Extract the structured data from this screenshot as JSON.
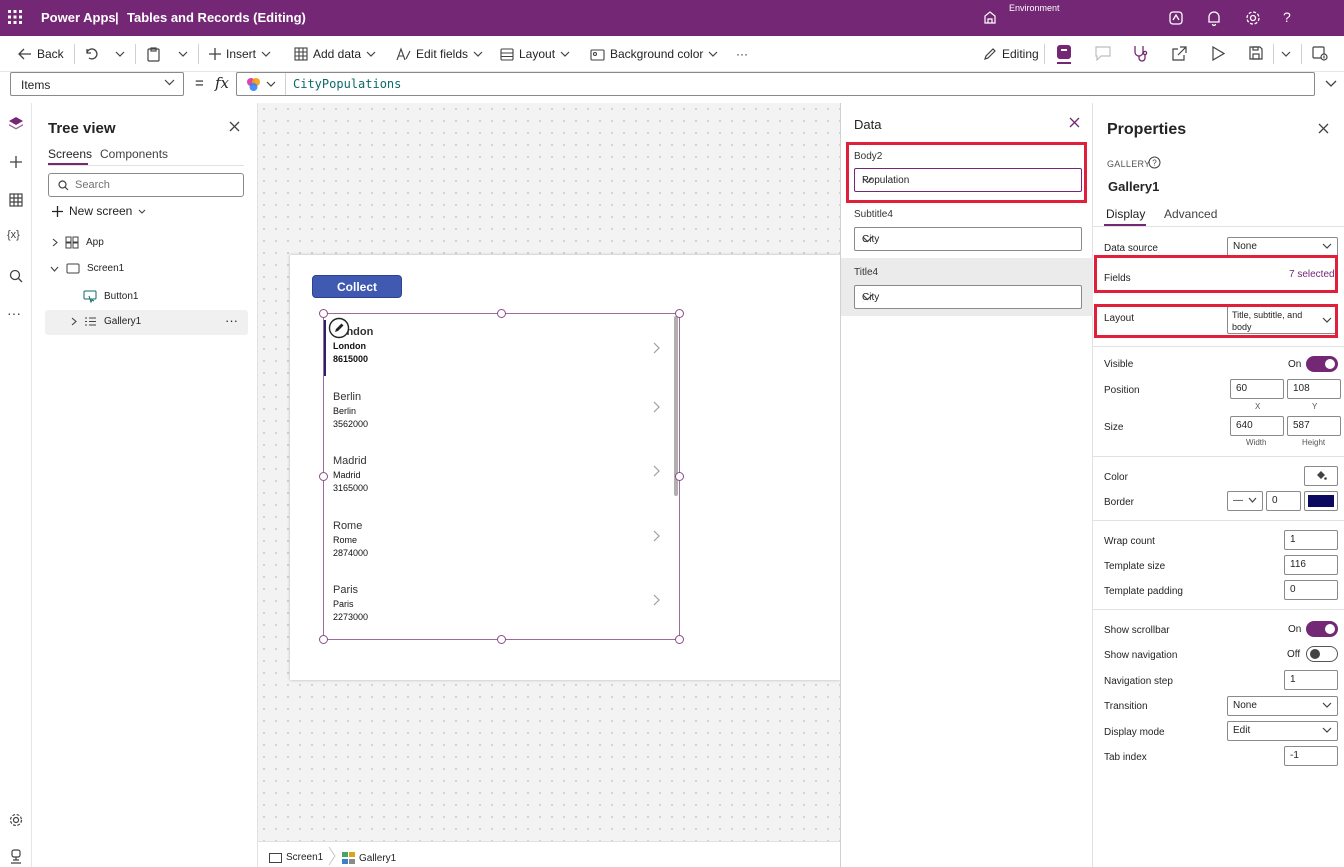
{
  "app": {
    "name": "Power Apps",
    "separator": "|",
    "document_title": "Tables and Records (Editing)",
    "environment_label": "Environment"
  },
  "commandbar": {
    "back": "Back",
    "insert": "Insert",
    "add_data": "Add data",
    "edit_fields": "Edit fields",
    "layout": "Layout",
    "background_color": "Background color",
    "more": "···",
    "editing": "Editing"
  },
  "formula": {
    "property": "Items",
    "equals": "=",
    "fx": "fx",
    "value": "CityPopulations"
  },
  "tree": {
    "title": "Tree view",
    "tabs": [
      "Screens",
      "Components"
    ],
    "search_placeholder": "Search",
    "new_screen": "New screen",
    "nodes": {
      "app": "App",
      "screen1": "Screen1",
      "button1": "Button1",
      "gallery1": "Gallery1",
      "more": "···"
    }
  },
  "canvas": {
    "collect_button": "Collect",
    "gallery_items": [
      {
        "title": "London",
        "subtitle": "London",
        "body": "8615000"
      },
      {
        "title": "Berlin",
        "subtitle": "Berlin",
        "body": "3562000"
      },
      {
        "title": "Madrid",
        "subtitle": "Madrid",
        "body": "3165000"
      },
      {
        "title": "Rome",
        "subtitle": "Rome",
        "body": "2874000"
      },
      {
        "title": "Paris",
        "subtitle": "Paris",
        "body": "2273000"
      }
    ]
  },
  "statusbar": {
    "screen": "Screen1",
    "gallery": "Gallery1"
  },
  "data_panel": {
    "title": "Data",
    "fields": [
      {
        "label": "Body2",
        "value": "Population"
      },
      {
        "label": "Subtitle4",
        "value": "City"
      },
      {
        "label": "Title4",
        "value": "City"
      }
    ]
  },
  "properties": {
    "title": "Properties",
    "control_kind": "GALLERY",
    "control_name": "Gallery1",
    "tabs": [
      "Display",
      "Advanced"
    ],
    "data_source_label": "Data source",
    "data_source_value": "None",
    "fields_label": "Fields",
    "fields_value": "7 selected",
    "layout_label": "Layout",
    "layout_value": "Title, subtitle, and body",
    "visible_label": "Visible",
    "visible_state": "On",
    "position_label": "Position",
    "position_x": "60",
    "position_y": "108",
    "x_caption": "X",
    "y_caption": "Y",
    "size_label": "Size",
    "width_value": "640",
    "height_value": "587",
    "width_caption": "Width",
    "height_caption": "Height",
    "color_label": "Color",
    "border_label": "Border",
    "border_style": "—",
    "border_width": "0",
    "border_color": "#0b0a5e",
    "wrap_count_label": "Wrap count",
    "wrap_count_value": "1",
    "template_size_label": "Template size",
    "template_size_value": "116",
    "template_padding_label": "Template padding",
    "template_padding_value": "0",
    "show_scrollbar_label": "Show scrollbar",
    "show_scrollbar_state": "On",
    "show_navigation_label": "Show navigation",
    "show_navigation_state": "Off",
    "navigation_step_label": "Navigation step",
    "navigation_step_value": "1",
    "transition_label": "Transition",
    "transition_value": "None",
    "display_mode_label": "Display mode",
    "display_mode_value": "Edit",
    "tab_index_label": "Tab index",
    "tab_index_value": "-1"
  },
  "colors": {
    "brand": "#742774",
    "highlight": "#e0203a",
    "button": "#3f5ab0"
  }
}
